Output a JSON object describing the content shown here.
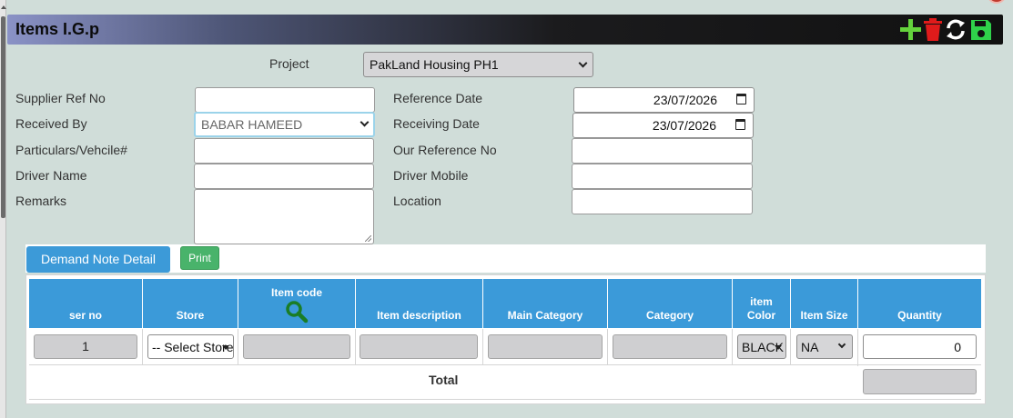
{
  "header": {
    "title": "Items I.G.p"
  },
  "toolbar": {
    "icons": [
      "add-icon",
      "delete-icon",
      "refresh-icon",
      "save-icon"
    ]
  },
  "form": {
    "project": {
      "label": "Project",
      "value": "PakLand Housing PH1"
    },
    "supplier_ref": {
      "label": "Supplier Ref No",
      "value": ""
    },
    "received_by": {
      "label": "Received By",
      "value": "BABAR HAMEED"
    },
    "particulars": {
      "label": "Particulars/Vehcile#",
      "value": ""
    },
    "driver_name": {
      "label": "Driver Name",
      "value": ""
    },
    "remarks": {
      "label": "Remarks",
      "value": ""
    },
    "reference_date": {
      "label": "Reference Date",
      "value": "23/07/2026"
    },
    "receiving_date": {
      "label": "Receiving Date",
      "value": "23/07/2026"
    },
    "our_ref": {
      "label": "Our Reference No",
      "value": ""
    },
    "driver_mobile": {
      "label": "Driver Mobile",
      "value": ""
    },
    "location": {
      "label": "Location",
      "value": ""
    }
  },
  "tabs": {
    "demand_note": "Demand Note Detail",
    "print": "Print"
  },
  "table": {
    "headers": {
      "ser_no": "ser no",
      "store": "Store",
      "item_code": "Item code",
      "item_description": "Item description",
      "main_category": "Main Category",
      "category": "Category",
      "item_color": "item Color",
      "item_size": "Item Size",
      "quantity": "Quantity"
    },
    "row": {
      "ser_no": "1",
      "store": "-- Select Store",
      "item_color": "BLACK",
      "item_size": "NA",
      "quantity": "0"
    },
    "total_label": "Total"
  },
  "colors": {
    "accent": "#3b9ad9",
    "print": "#49b36b",
    "background": "#d0ddd9"
  }
}
